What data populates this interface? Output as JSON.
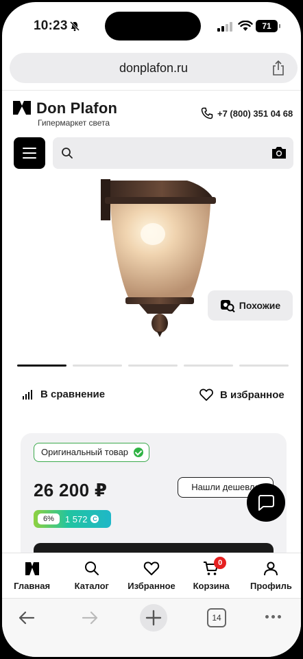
{
  "status_bar": {
    "time": "10:23",
    "battery": "71"
  },
  "browser": {
    "url": "donplafon.ru",
    "tab_count": "14"
  },
  "site": {
    "logo_name": "Don Plafon",
    "logo_sub": "Гипермаркет света",
    "phone": "+7 (800) 351 04 68",
    "search_placeholder": ""
  },
  "product": {
    "similar_label": "Похожие",
    "compare_label": "В сравнение",
    "favorite_label": "В избранное",
    "original_badge": "Оригинальный товар",
    "price": "26 200 ₽",
    "cheaper_label": "Нашли дешевле",
    "bonus_percent": "6%",
    "bonus_value": "1 572",
    "bonus_currency": "С"
  },
  "bottom_nav": {
    "home": "Главная",
    "catalog": "Каталог",
    "favorites": "Избранное",
    "cart": "Корзина",
    "cart_count": "0",
    "profile": "Профиль"
  },
  "colors": {
    "accent_green": "#2fb344",
    "badge_red": "#e52020"
  }
}
